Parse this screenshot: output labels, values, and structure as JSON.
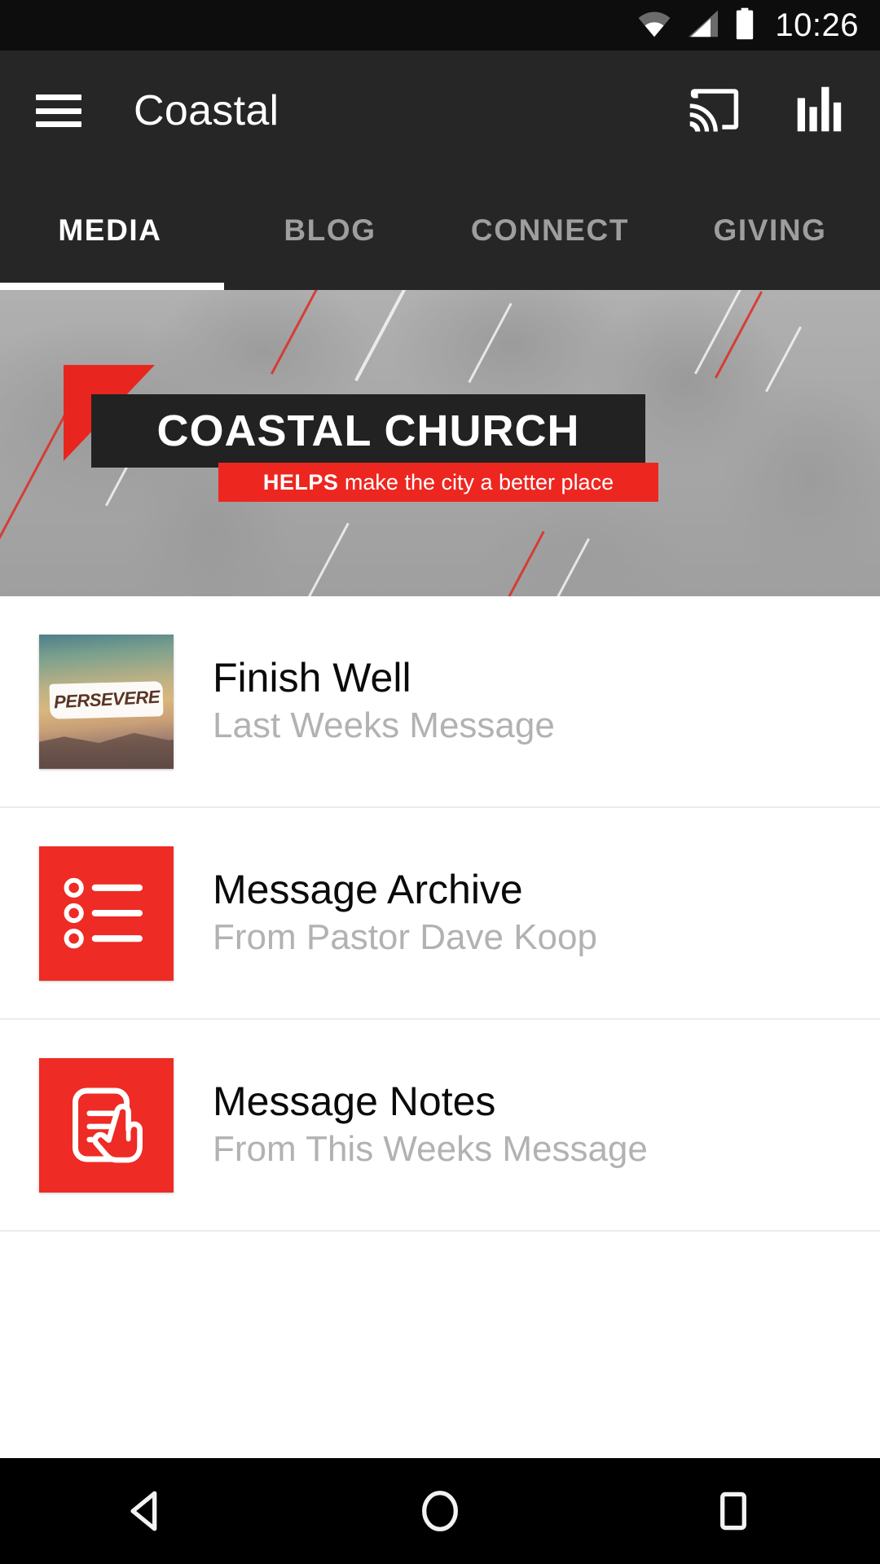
{
  "status_bar": {
    "time": "10:26",
    "icons": [
      "wifi-icon",
      "cellular-signal-icon",
      "battery-icon"
    ]
  },
  "app_bar": {
    "menu_icon": "hamburger-menu-icon",
    "title": "Coastal",
    "actions": [
      {
        "icon": "chromecast-icon",
        "label": "Cast"
      },
      {
        "icon": "equalizer-icon",
        "label": "Equalizer"
      }
    ]
  },
  "tabs": {
    "items": [
      {
        "label": "MEDIA",
        "active": true
      },
      {
        "label": "BLOG",
        "active": false
      },
      {
        "label": "CONNECT",
        "active": false
      },
      {
        "label": "GIVING",
        "active": false
      }
    ]
  },
  "hero": {
    "headline": "COASTAL CHURCH",
    "tagline_bold": "HELPS",
    "tagline_rest": " make the city a better place"
  },
  "list": {
    "items": [
      {
        "title": "Finish Well",
        "subtitle": "Last Weeks Message",
        "thumb_type": "artwork",
        "thumb_text": "PERSEVERE",
        "icon": "message-artwork-thumbnail"
      },
      {
        "title": "Message Archive",
        "subtitle": "From Pastor Dave Koop",
        "thumb_type": "tile",
        "icon": "bulleted-list-icon"
      },
      {
        "title": "Message Notes",
        "subtitle": "From This Weeks Message",
        "thumb_type": "tile",
        "icon": "document-tap-icon"
      }
    ]
  },
  "nav_bar": {
    "buttons": [
      {
        "icon": "back-icon",
        "label": "Back"
      },
      {
        "icon": "home-icon",
        "label": "Home"
      },
      {
        "icon": "recents-icon",
        "label": "Recents"
      }
    ]
  },
  "colors": {
    "accent_red": "#ee2b24",
    "appbar_dark": "#262626",
    "statusbar_dark": "#0d0d0d",
    "tab_inactive": "#9e9e9e",
    "subtitle_gray": "#b2b2b2"
  }
}
